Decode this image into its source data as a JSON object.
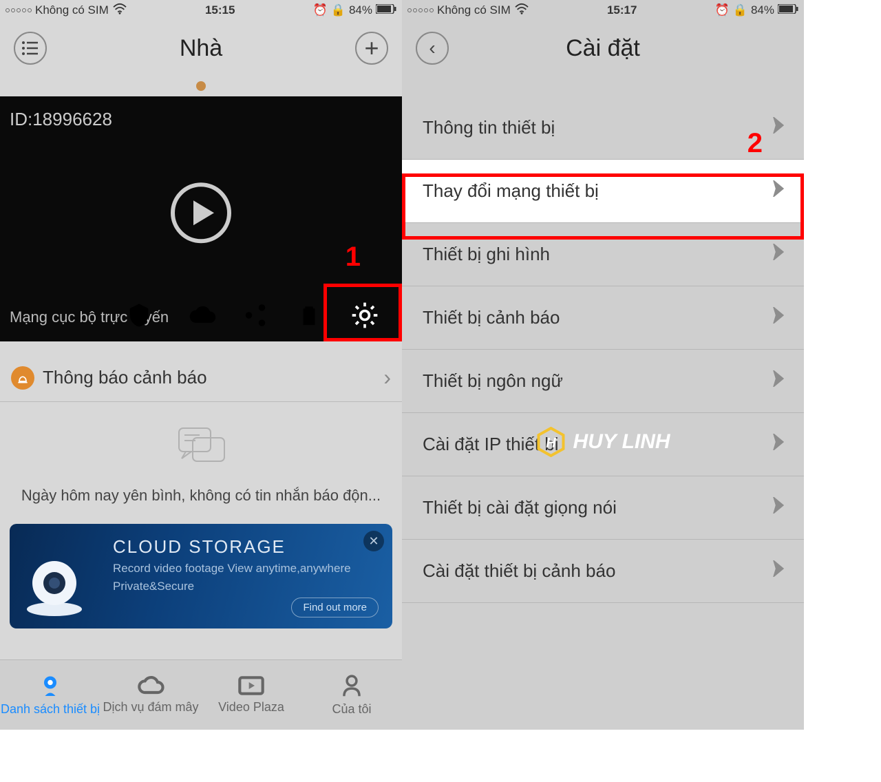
{
  "left": {
    "status": {
      "carrier": "Không có SIM",
      "time": "15:15",
      "battery": "84%"
    },
    "nav": {
      "title": "Nhà"
    },
    "camera": {
      "id": "ID:18996628",
      "status": "Mạng cục bộ trực tuyến"
    },
    "alert": {
      "label": "Thông báo cảnh báo"
    },
    "empty": {
      "text": "Ngày hôm nay yên bình, không có tin nhắn báo độn..."
    },
    "banner": {
      "title": "CLOUD STORAGE",
      "line1": "Record video footage   View anytime,anywhere",
      "line2": "Private&Secure",
      "cta": "Find out more"
    },
    "tabs": [
      {
        "label": "Danh sách thiết bị"
      },
      {
        "label": "Dịch vụ đám mây"
      },
      {
        "label": "Video Plaza"
      },
      {
        "label": "Của tôi"
      }
    ],
    "annotation": {
      "one": "1"
    }
  },
  "right": {
    "status": {
      "carrier": "Không có SIM",
      "time": "15:17",
      "battery": "84%"
    },
    "nav": {
      "title": "Cài đặt"
    },
    "rows": [
      {
        "label": "Thông tin thiết bị"
      },
      {
        "label": "Thay đổi mạng thiết bị"
      },
      {
        "label": "Thiết bị ghi hình"
      },
      {
        "label": "Thiết bị cảnh báo"
      },
      {
        "label": "Thiết bị ngôn ngữ"
      },
      {
        "label": "Cài đặt IP thiết bị"
      },
      {
        "label": "Thiết bị cài đặt giọng nói"
      },
      {
        "label": "Cài đặt thiết bị cảnh báo"
      }
    ],
    "annotation": {
      "two": "2"
    },
    "watermark": "HUY LINH"
  }
}
